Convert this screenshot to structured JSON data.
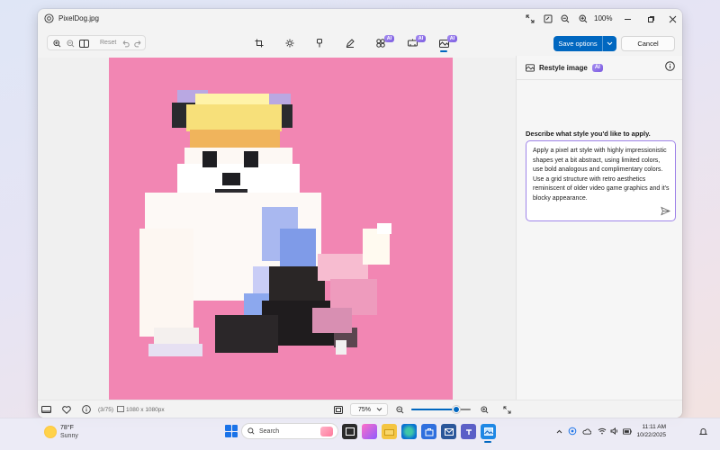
{
  "window": {
    "title": "PixelDog.jpg",
    "zoom_percent": "100%"
  },
  "toolbar": {
    "reset_label": "Reset",
    "ai_badge": "AI",
    "save_label": "Save options",
    "cancel_label": "Cancel"
  },
  "panel": {
    "title": "Restyle image",
    "ai_badge": "AI",
    "prompt_label": "Describe what style you'd like to apply.",
    "prompt_text": "Apply a pixel art style with highly impressionistic shapes yet a bit abstract, using limited colors, use bold analogous and complimentary colors. Use a grid structure with retro aesthetics reminiscent of older video game graphics and it's blocky appearance."
  },
  "statusbar": {
    "counter": "(3/75)",
    "dimensions": "1080 x 1080px",
    "zoom_value": "75%",
    "zoom_level": 0.75
  },
  "taskbar": {
    "weather_temp": "78°F",
    "weather_desc": "Sunny",
    "search_placeholder": "Search",
    "time": "11:11 AM",
    "date": "10/22/2025"
  },
  "colors": {
    "accent": "#0067c0",
    "image_background": "#f286b3",
    "ai_badge": "#8a6be8"
  }
}
